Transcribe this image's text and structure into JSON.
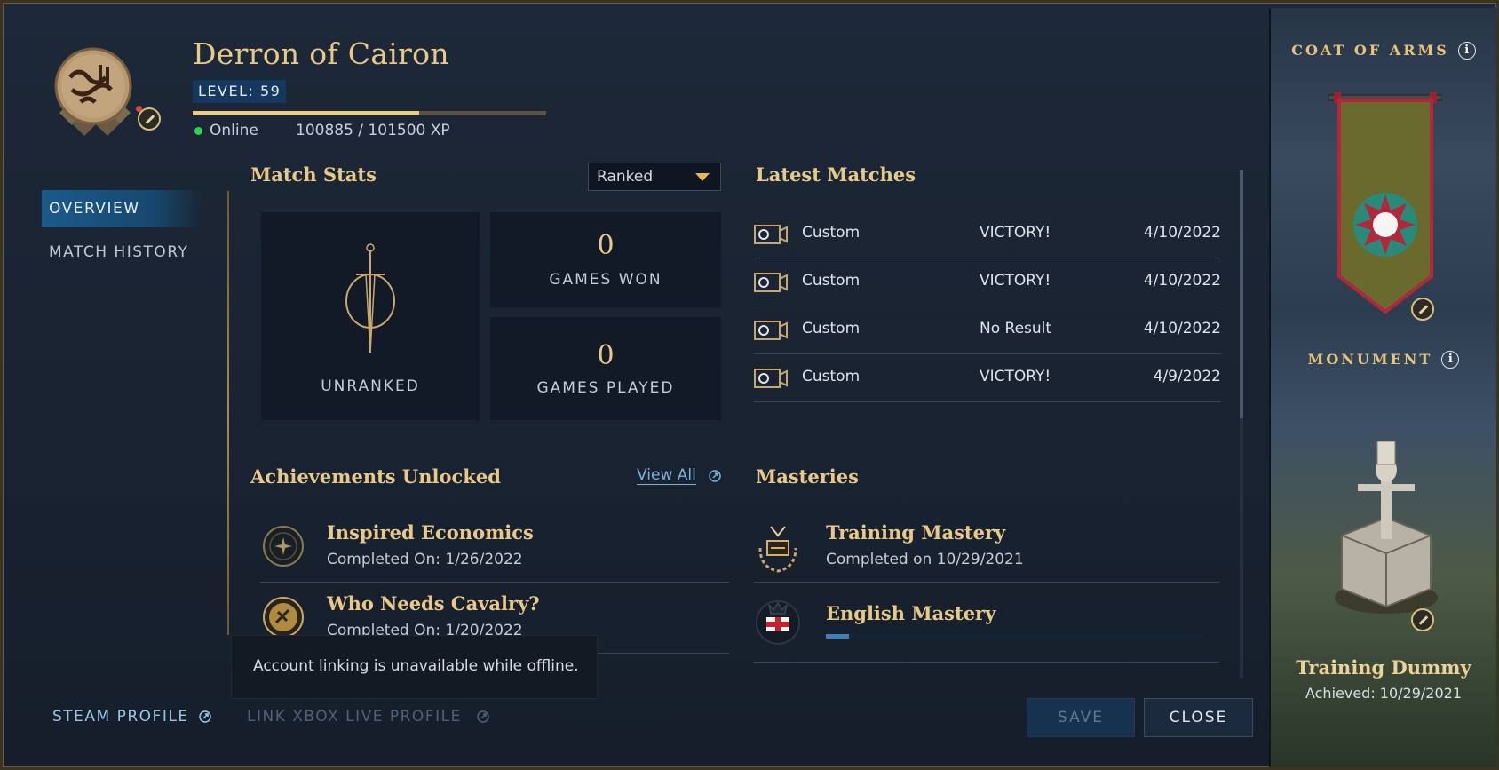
{
  "profile": {
    "name": "Derron of Cairon",
    "level_label": "LEVEL: 59",
    "status": "Online",
    "xp_text": "100885 / 101500 XP",
    "xp_fraction": 0.64
  },
  "nav": {
    "items": [
      {
        "label": "OVERVIEW",
        "active": true
      },
      {
        "label": "MATCH HISTORY",
        "active": false
      }
    ]
  },
  "match_stats": {
    "title": "Match Stats",
    "dropdown_value": "Ranked",
    "rank_label": "UNRANKED",
    "games_won_value": "0",
    "games_won_label": "GAMES WON",
    "games_played_value": "0",
    "games_played_label": "GAMES PLAYED"
  },
  "latest_matches": {
    "title": "Latest Matches",
    "rows": [
      {
        "mode": "Custom",
        "result": "VICTORY!",
        "date": "4/10/2022"
      },
      {
        "mode": "Custom",
        "result": "VICTORY!",
        "date": "4/10/2022"
      },
      {
        "mode": "Custom",
        "result": "No Result",
        "date": "4/10/2022"
      },
      {
        "mode": "Custom",
        "result": "VICTORY!",
        "date": "4/9/2022"
      }
    ]
  },
  "achievements": {
    "title": "Achievements Unlocked",
    "view_all": "View All",
    "items": [
      {
        "title": "Inspired Economics",
        "sub": "Completed On: 1/26/2022"
      },
      {
        "title": "Who Needs Cavalry?",
        "sub": "Completed On: 1/20/2022"
      }
    ]
  },
  "masteries": {
    "title": "Masteries",
    "items": [
      {
        "title": "Training Mastery",
        "sub": "Completed on 10/29/2021"
      },
      {
        "title": "English Mastery",
        "progress": 0.06
      }
    ]
  },
  "tooltip": "Account linking is unavailable while offline.",
  "footer": {
    "steam": "STEAM PROFILE",
    "xbox": "LINK XBOX LIVE PROFILE",
    "save": "SAVE",
    "close": "CLOSE"
  },
  "right_panel": {
    "coat_heading": "COAT OF ARMS",
    "monument_heading": "MONUMENT",
    "monument_name": "Training Dummy",
    "monument_sub": "Achieved: 10/29/2021"
  },
  "colors": {
    "gold": "#e9c987",
    "accent_blue": "#1b5a8c",
    "banner_olive": "#6b6a2e",
    "banner_red": "#b0283a",
    "online_green": "#2ad64a"
  }
}
